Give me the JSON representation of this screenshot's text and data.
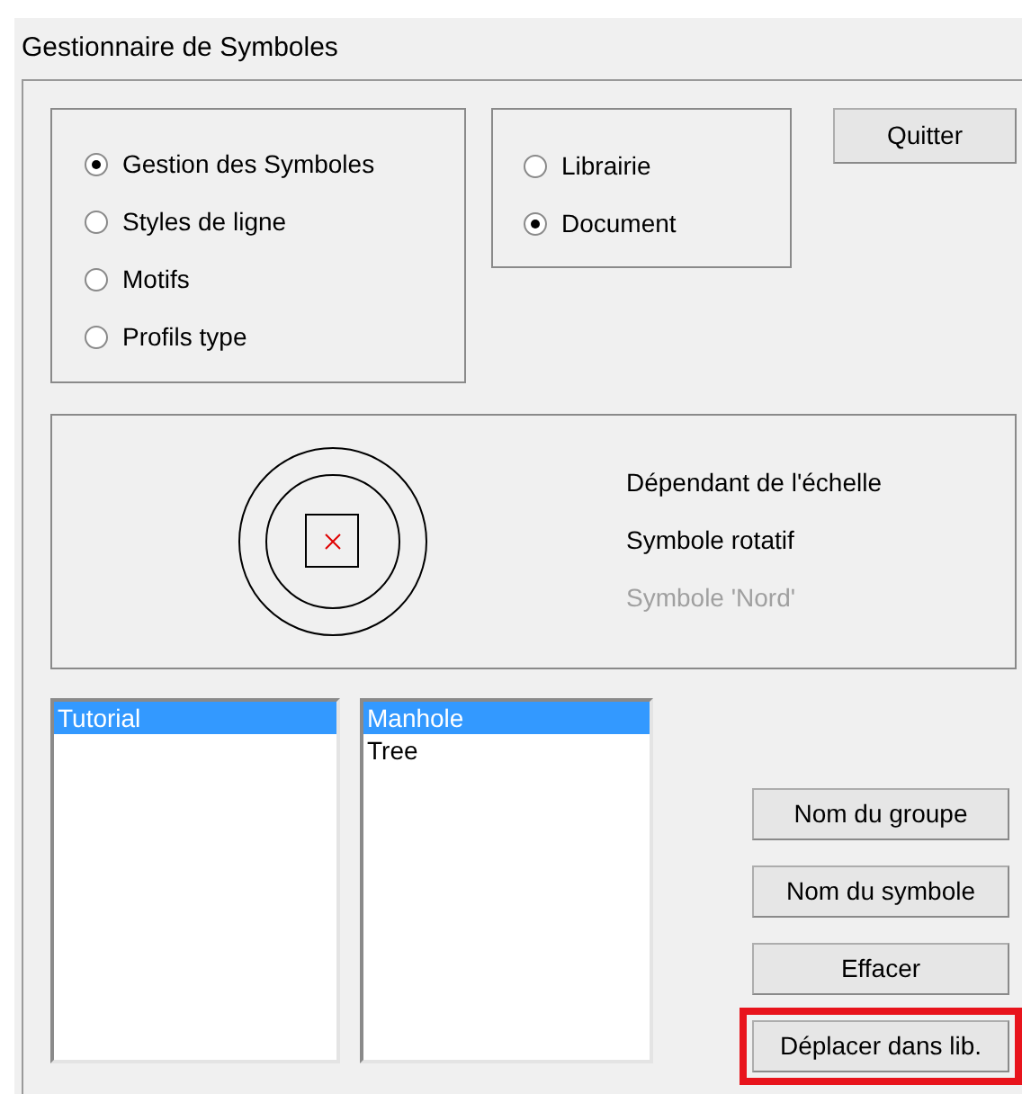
{
  "window": {
    "title": "Gestionnaire de Symboles"
  },
  "mode_options": [
    {
      "label": "Gestion des Symboles",
      "selected": true
    },
    {
      "label": "Styles de ligne",
      "selected": false
    },
    {
      "label": "Motifs",
      "selected": false
    },
    {
      "label": "Profils type",
      "selected": false
    }
  ],
  "source_options": [
    {
      "label": "Librairie",
      "selected": false
    },
    {
      "label": "Document",
      "selected": true
    }
  ],
  "quit_button": "Quitter",
  "symbol_properties": [
    {
      "label": "Dépendant de l'échelle",
      "disabled": false
    },
    {
      "label": "Symbole rotatif",
      "disabled": false
    },
    {
      "label": "Symbole 'Nord'",
      "disabled": true
    }
  ],
  "groups_list": [
    {
      "label": "Tutorial",
      "selected": true
    }
  ],
  "symbols_list": [
    {
      "label": "Manhole",
      "selected": true
    },
    {
      "label": "Tree",
      "selected": false
    }
  ],
  "action_buttons": [
    {
      "label": "Nom du groupe",
      "highlighted": false
    },
    {
      "label": "Nom du symbole",
      "highlighted": false
    },
    {
      "label": "Effacer",
      "highlighted": false
    },
    {
      "label": "Déplacer dans lib.",
      "highlighted": true
    }
  ]
}
